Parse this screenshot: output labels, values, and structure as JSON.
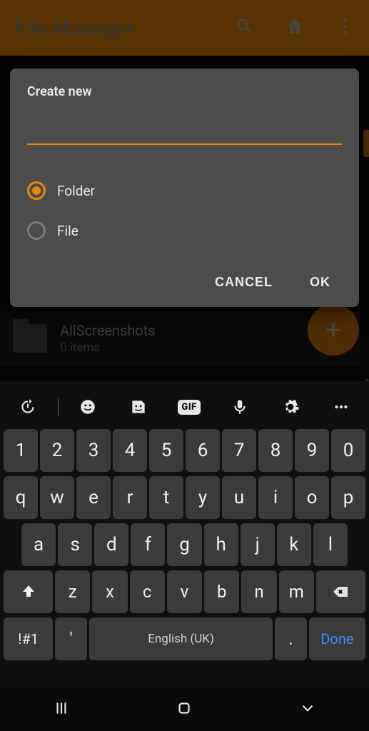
{
  "app": {
    "title": "File Manager"
  },
  "folder": {
    "name": "AllScreenshots",
    "meta": "0 items"
  },
  "dialog": {
    "title": "Create new",
    "input_value": "",
    "option_folder": "Folder",
    "option_file": "File",
    "selected": "folder",
    "cancel": "CANCEL",
    "ok": "OK"
  },
  "keyboard": {
    "row_num": [
      "1",
      "2",
      "3",
      "4",
      "5",
      "6",
      "7",
      "8",
      "9",
      "0"
    ],
    "row_q": [
      "q",
      "w",
      "e",
      "r",
      "t",
      "y",
      "u",
      "i",
      "o",
      "p"
    ],
    "row_a": [
      "a",
      "s",
      "d",
      "f",
      "g",
      "h",
      "j",
      "k",
      "l"
    ],
    "row_z": [
      "z",
      "x",
      "c",
      "v",
      "b",
      "n",
      "m"
    ],
    "sym": "!#1",
    "apos": "'",
    "space": "English (UK)",
    "period": ".",
    "done": "Done"
  },
  "tools_gif": "GIF"
}
